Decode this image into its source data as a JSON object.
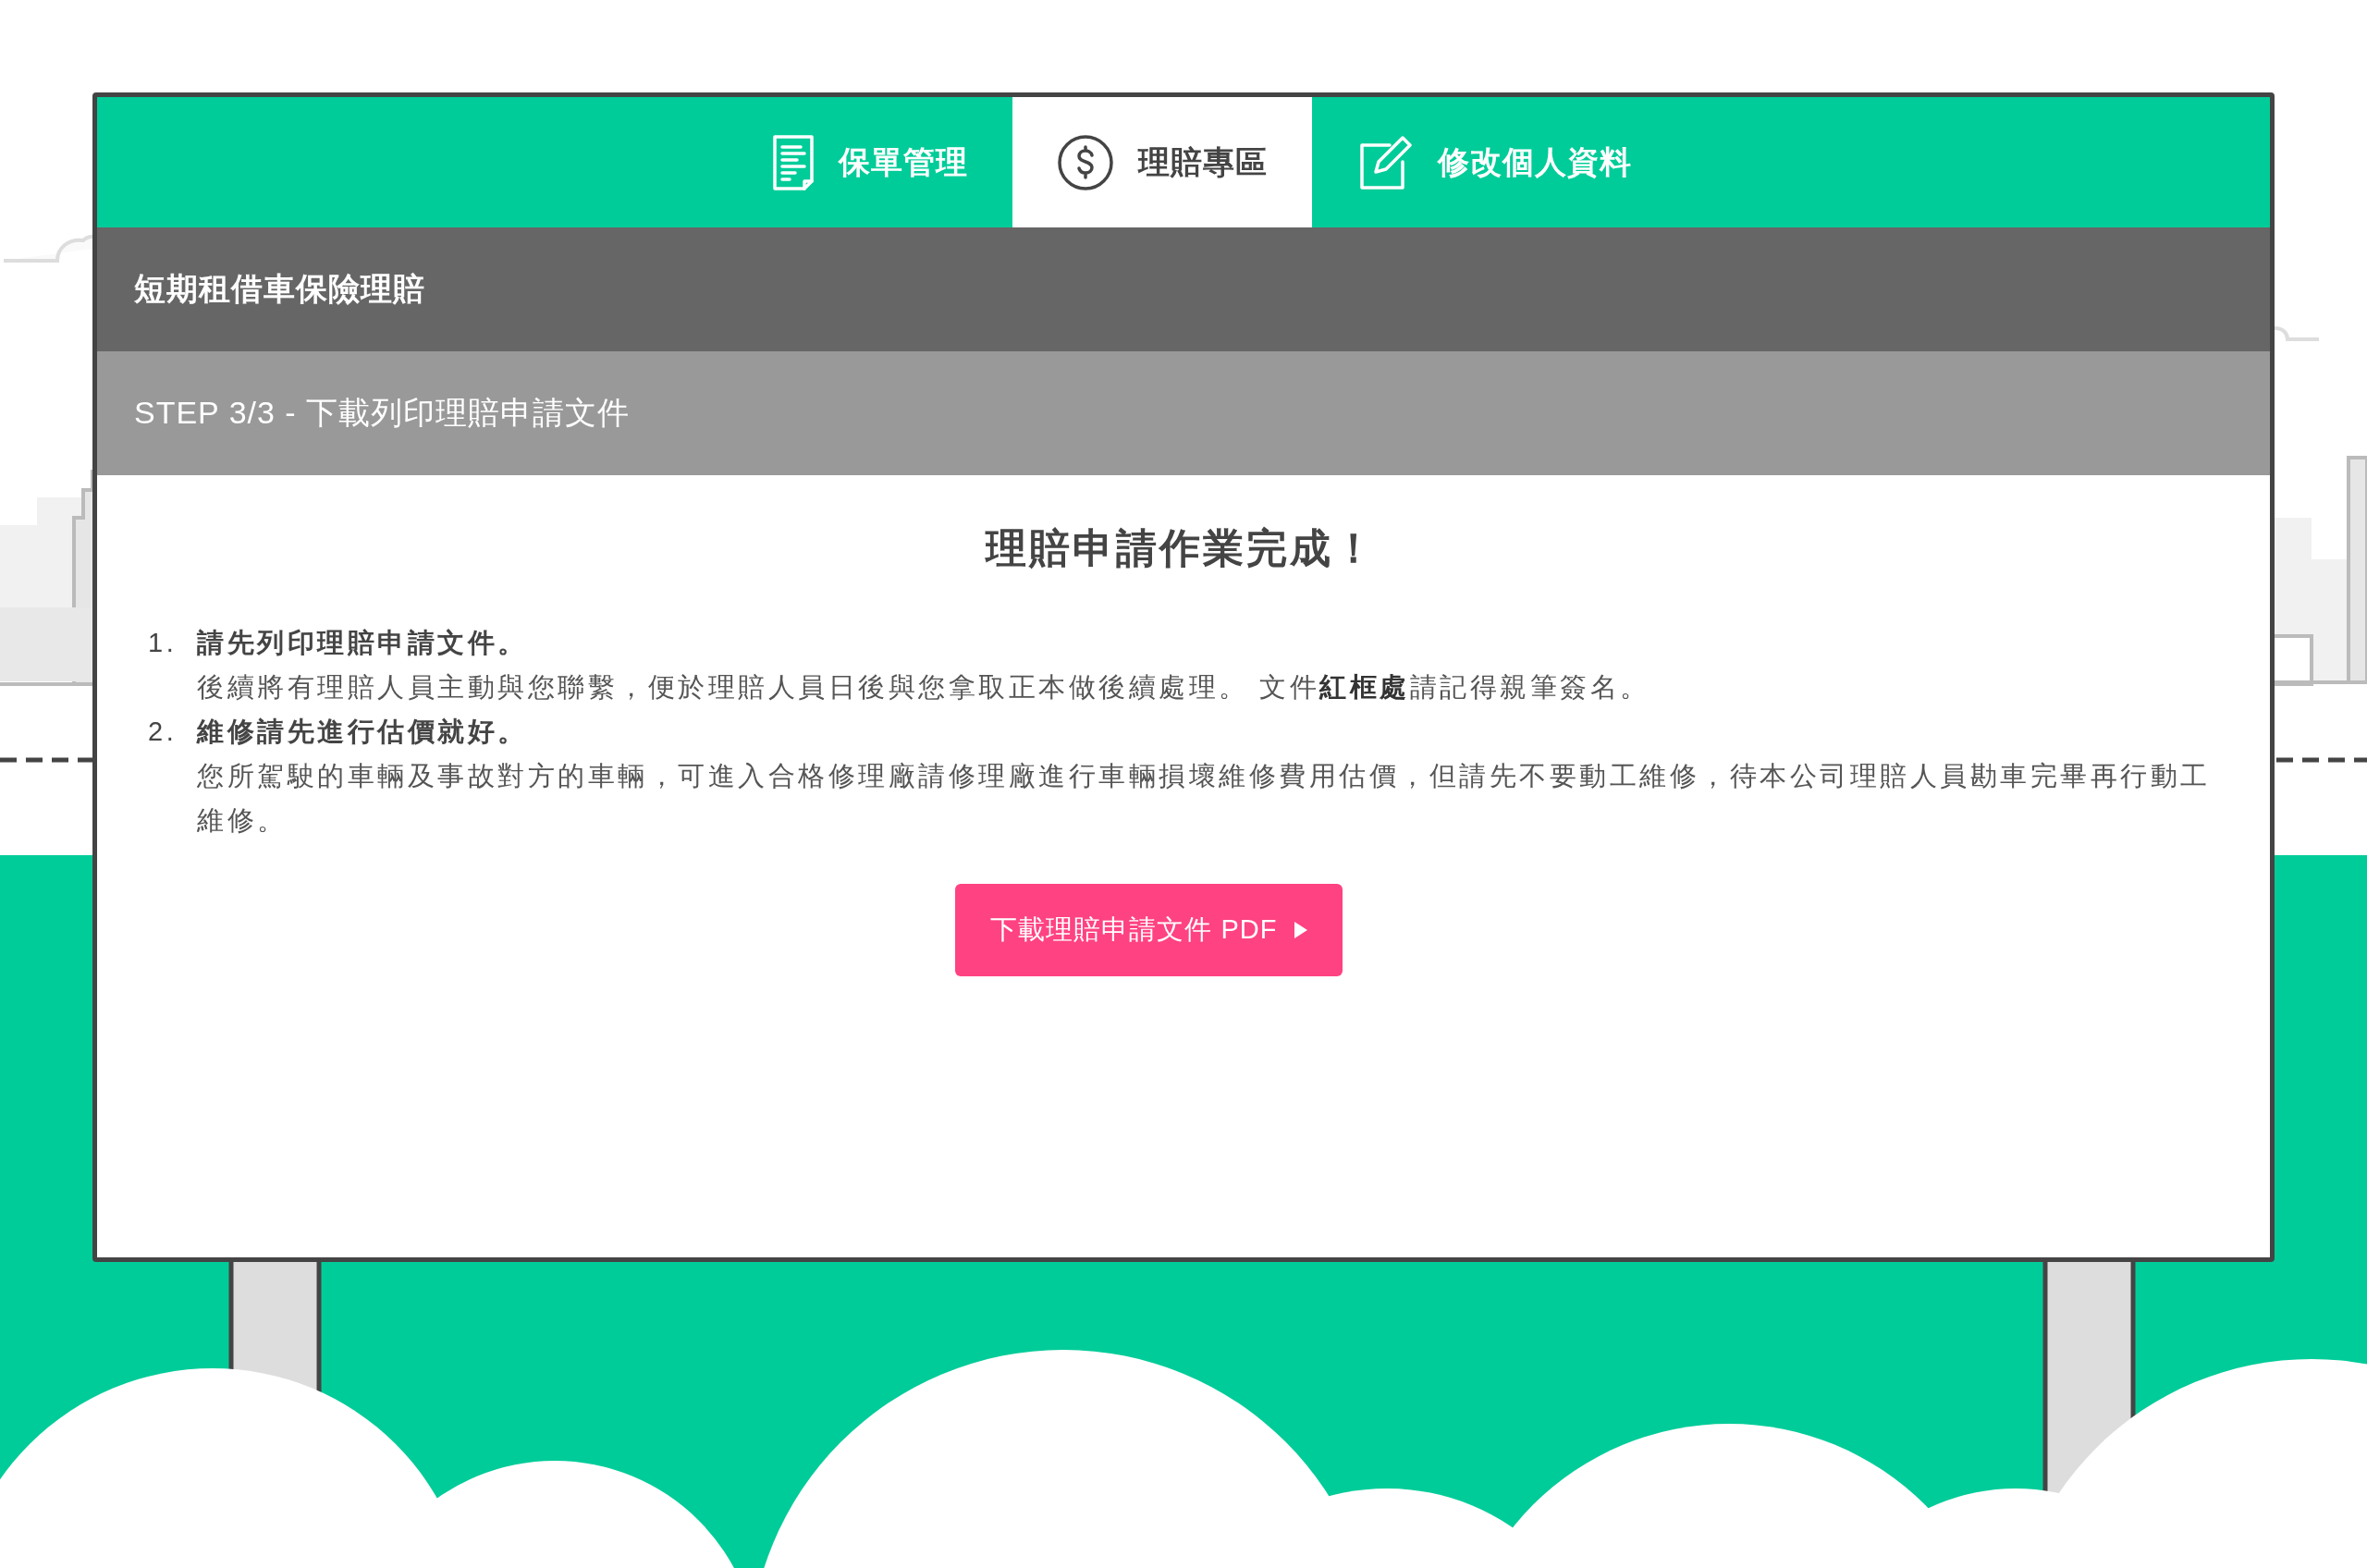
{
  "tabs": [
    {
      "label": "保單管理",
      "selected": false
    },
    {
      "label": "理賠專區",
      "selected": true
    },
    {
      "label": "修改個人資料",
      "selected": false
    }
  ],
  "page_title": "短期租借車保險理賠",
  "step_title": "STEP 3/3 - 下載列印理賠申請文件",
  "heading": "理賠申請作業完成！",
  "steps": [
    {
      "number": "1.",
      "title": "請先列印理賠申請文件。",
      "body": "後續將有理賠人員主動與您聯繫，便於理賠人員日後與您拿取正本做後續處理。 文件**紅框處**請記得親筆簽名。"
    },
    {
      "number": "2.",
      "title": "維修請先進行估價就好。",
      "body": "您所駕駛的車輛及事故對方的車輛，可進入合格修理廠請修理廠進行車輛損壞維修費用估價，但請先不要動工維修，待本公司理賠人員勘車完畢再行動工維修。"
    }
  ],
  "download_button": {
    "label": "下載理賠申請文件 PDF"
  }
}
